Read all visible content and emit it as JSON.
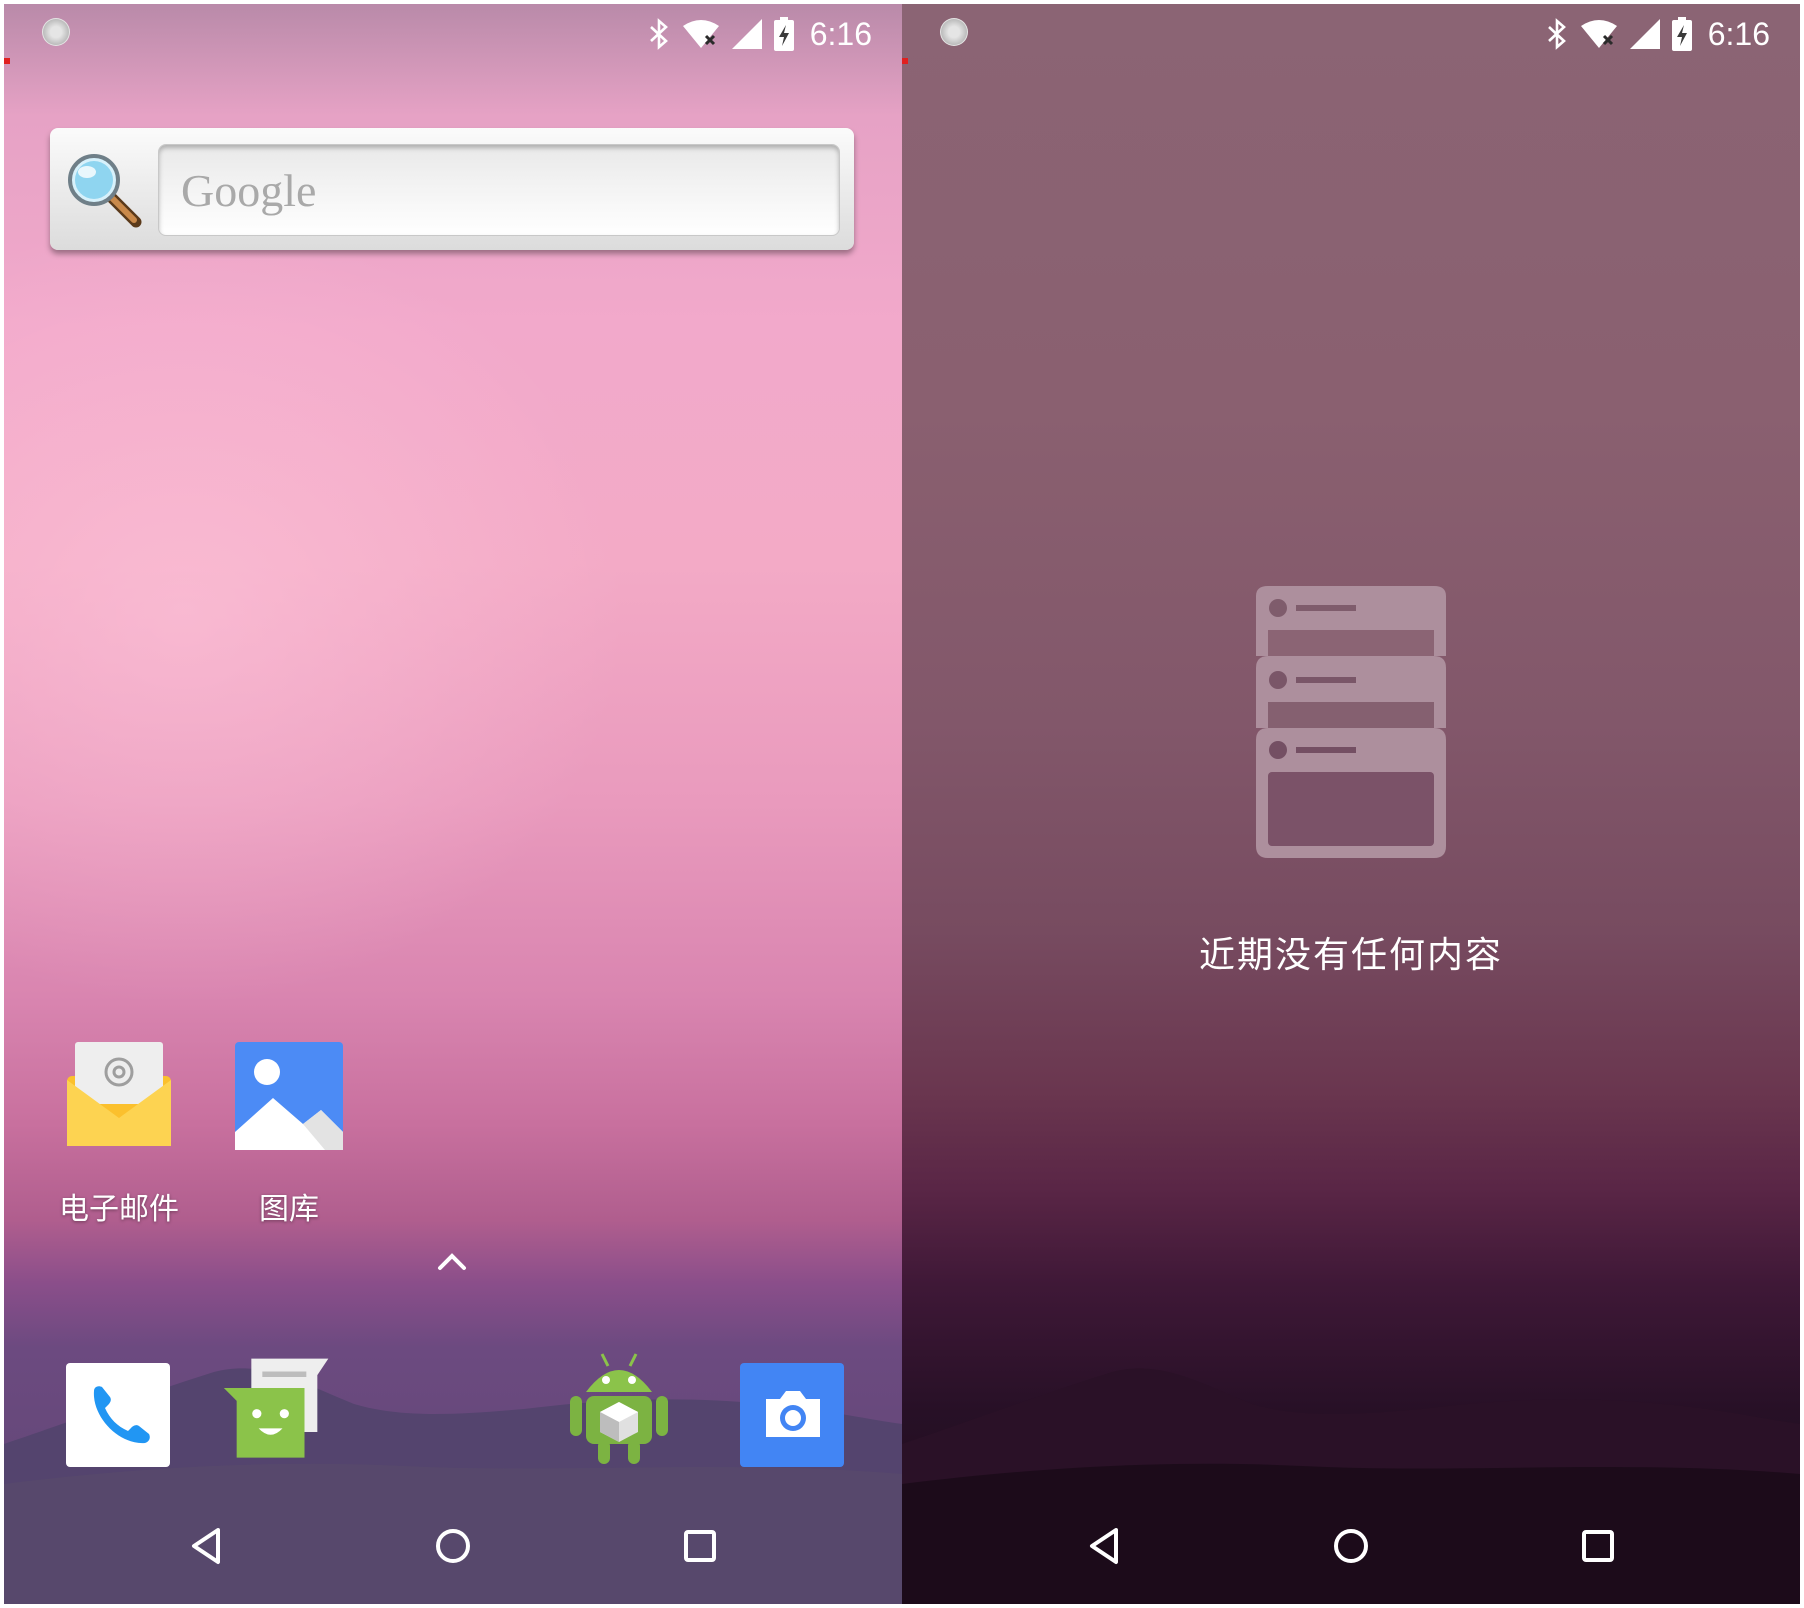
{
  "status_bar": {
    "time": "6:16",
    "icons": [
      "bluetooth-icon",
      "wifi-icon",
      "signal-icon",
      "battery-charging-icon"
    ]
  },
  "home": {
    "search": {
      "placeholder": "Google"
    },
    "apps": [
      {
        "label": "电子邮件",
        "icon": "email-icon"
      },
      {
        "label": "图库",
        "icon": "gallery-icon"
      }
    ],
    "dock": [
      "phone-icon",
      "messaging-icon",
      "android-app-icon",
      "camera-icon"
    ]
  },
  "recents": {
    "empty_text": "近期没有任何内容",
    "icon": "recents-stack-icon"
  },
  "nav_bar": {
    "buttons": [
      "back-icon",
      "home-icon",
      "overview-icon"
    ]
  },
  "colors": {
    "status_text": "#ffffff",
    "accent_blue": "#4285f4",
    "accent_green": "#8bc34a",
    "email_yellow": "#fbc02d"
  }
}
